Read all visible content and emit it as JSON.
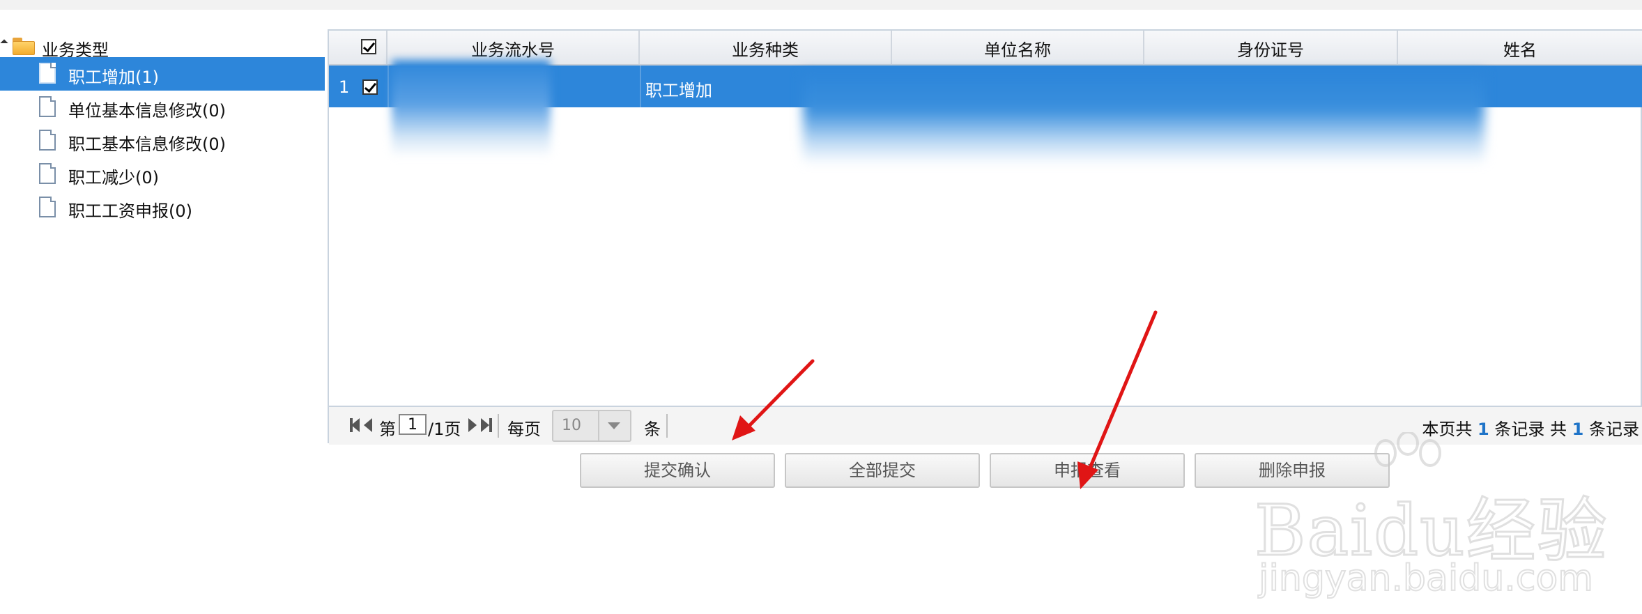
{
  "tree": {
    "root_label": "业务类型",
    "items": [
      {
        "label": "职工增加(1)",
        "selected": true
      },
      {
        "label": "单位基本信息修改(0)",
        "selected": false
      },
      {
        "label": "职工基本信息修改(0)",
        "selected": false
      },
      {
        "label": "职工减少(0)",
        "selected": false
      },
      {
        "label": "职工工资申报(0)",
        "selected": false
      }
    ]
  },
  "grid": {
    "columns": [
      "业务流水号",
      "业务种类",
      "单位名称",
      "身份证号",
      "姓名"
    ],
    "header_checkbox_checked": true,
    "rows": [
      {
        "index": "1",
        "checked": true,
        "serial": "",
        "kind": "职工增加",
        "unit": "",
        "id_number": "",
        "name": ""
      }
    ]
  },
  "pager": {
    "page_prefix": "第",
    "current_page": "1",
    "page_suffix": "/1页",
    "per_page_label": "每页",
    "per_page_value": "10",
    "per_page_unit": "条",
    "summary": {
      "part1": "本页共",
      "page_count": "1",
      "part2": "条记录 共",
      "total_count": "1",
      "part3": "条记录"
    }
  },
  "actions": {
    "submit_confirm": "提交确认",
    "submit_all": "全部提交",
    "view_declaration": "申报查看",
    "delete_declaration": "删除申报"
  },
  "watermark": {
    "brand": "Baidu经验",
    "url": "jingyan.baidu.com"
  },
  "colors": {
    "selection": "#2d86da",
    "annotation_arrow": "#e01515"
  }
}
